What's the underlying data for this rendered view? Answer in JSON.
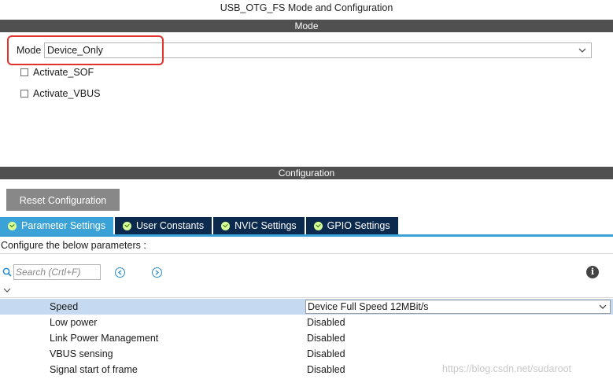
{
  "window": {
    "title": "USB_OTG_FS Mode and Configuration"
  },
  "mode_section": {
    "header": "Mode",
    "mode_label": "Mode",
    "mode_value": "Device_Only",
    "checkboxes": [
      {
        "label": "Activate_SOF",
        "checked": false
      },
      {
        "label": "Activate_VBUS",
        "checked": false
      }
    ]
  },
  "config_section": {
    "header": "Configuration",
    "reset_button": "Reset Configuration",
    "tabs": [
      {
        "label": "Parameter Settings",
        "active": true
      },
      {
        "label": "User Constants",
        "active": false
      },
      {
        "label": "NVIC Settings",
        "active": false
      },
      {
        "label": "GPIO Settings",
        "active": false
      }
    ],
    "instructions": "Configure the below parameters :",
    "search": {
      "placeholder": "Search (Crtl+F)",
      "value": ""
    },
    "parameters": [
      {
        "name": "Speed",
        "value": "Device Full Speed 12MBit/s",
        "editable": true
      },
      {
        "name": "Low power",
        "value": "Disabled"
      },
      {
        "name": "Link Power Management",
        "value": "Disabled"
      },
      {
        "name": "VBUS sensing",
        "value": "Disabled"
      },
      {
        "name": "Signal start of frame",
        "value": "Disabled"
      }
    ]
  },
  "watermark": "https://blog.csdn.net/sudaroot",
  "colors": {
    "section_bar": "#505050",
    "tab_active": "#3aa2d6",
    "tab_inactive": "#0b2a4e",
    "highlight": "#e0352b",
    "selected_row": "#c5daf1"
  },
  "icons": [
    "search-icon",
    "previous-icon",
    "next-icon",
    "info-icon",
    "collapse-icon",
    "chevron-down-icon",
    "check-circle-icon"
  ]
}
